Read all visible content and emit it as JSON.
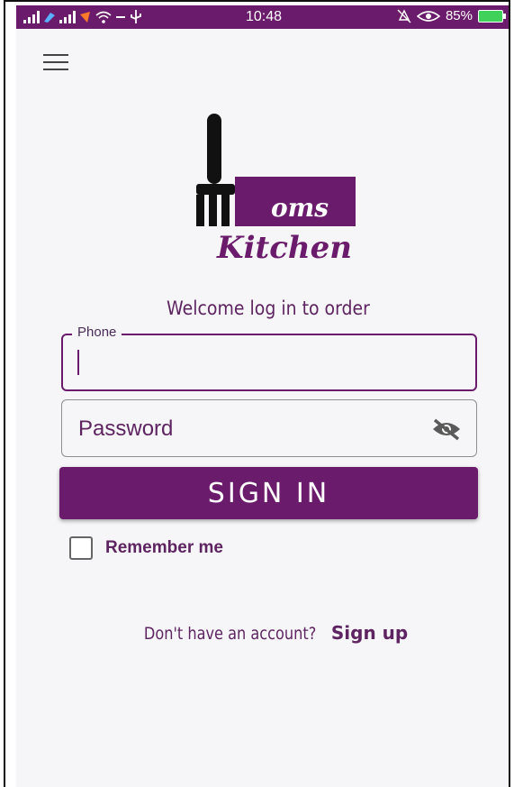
{
  "status_bar": {
    "time": "10:48",
    "battery": "85%"
  },
  "logo": {
    "word_top": "oms",
    "word_bottom": "Kitchen"
  },
  "welcome_text": "Welcome log in to order",
  "phone": {
    "label": "Phone",
    "value": ""
  },
  "password": {
    "placeholder": "Password"
  },
  "signin": {
    "label": "SIGN IN"
  },
  "remember": {
    "label": "Remember me",
    "checked": false
  },
  "signup": {
    "prompt": "Don't have an account?",
    "link": "Sign up"
  },
  "colors": {
    "primary": "#6a1b6b",
    "text_accent": "#5e2461",
    "background": "#f6f6f8"
  }
}
